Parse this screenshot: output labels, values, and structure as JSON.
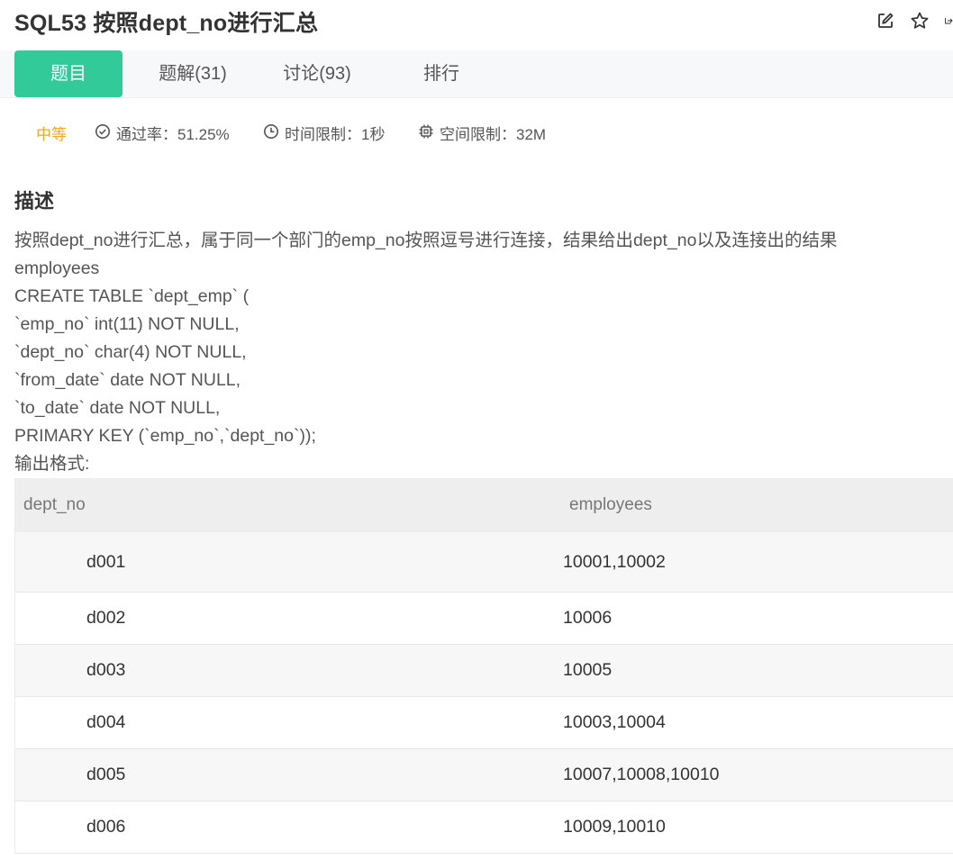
{
  "header": {
    "title": "SQL53  按照dept_no进行汇总",
    "actions": [
      "edit-icon",
      "star-icon",
      "share-icon"
    ]
  },
  "tabs": [
    {
      "label": "题目",
      "active": true
    },
    {
      "label": "题解(31)",
      "active": false
    },
    {
      "label": "讨论(93)",
      "active": false
    },
    {
      "label": "排行",
      "active": false
    }
  ],
  "meta": {
    "difficulty": "中等",
    "pass_rate": "通过率：51.25%",
    "time_limit": "时间限制：1秒",
    "space_limit": "空间限制：32M"
  },
  "section": {
    "title": "描述"
  },
  "description": {
    "lines": [
      "按照dept_no进行汇总，属于同一个部门的emp_no按照逗号进行连接，结果给出dept_no以及连接出的结果",
      "employees",
      "CREATE TABLE `dept_emp` (",
      "`emp_no` int(11) NOT NULL,",
      "`dept_no` char(4) NOT NULL,",
      "`from_date` date NOT NULL,",
      "`to_date` date NOT NULL,",
      "PRIMARY KEY (`emp_no`,`dept_no`));",
      "输出格式:"
    ]
  },
  "output_table": {
    "columns": [
      "dept_no",
      "employees"
    ],
    "rows": [
      [
        "d001",
        "10001,10002"
      ],
      [
        "d002",
        "10006"
      ],
      [
        "d003",
        "10005"
      ],
      [
        "d004",
        "10003,10004"
      ],
      [
        "d005",
        "10007,10008,10010"
      ],
      [
        "d006",
        "10009,10010"
      ]
    ]
  },
  "colors": {
    "accent": "#32ca99",
    "difficulty": "#f5a623"
  }
}
